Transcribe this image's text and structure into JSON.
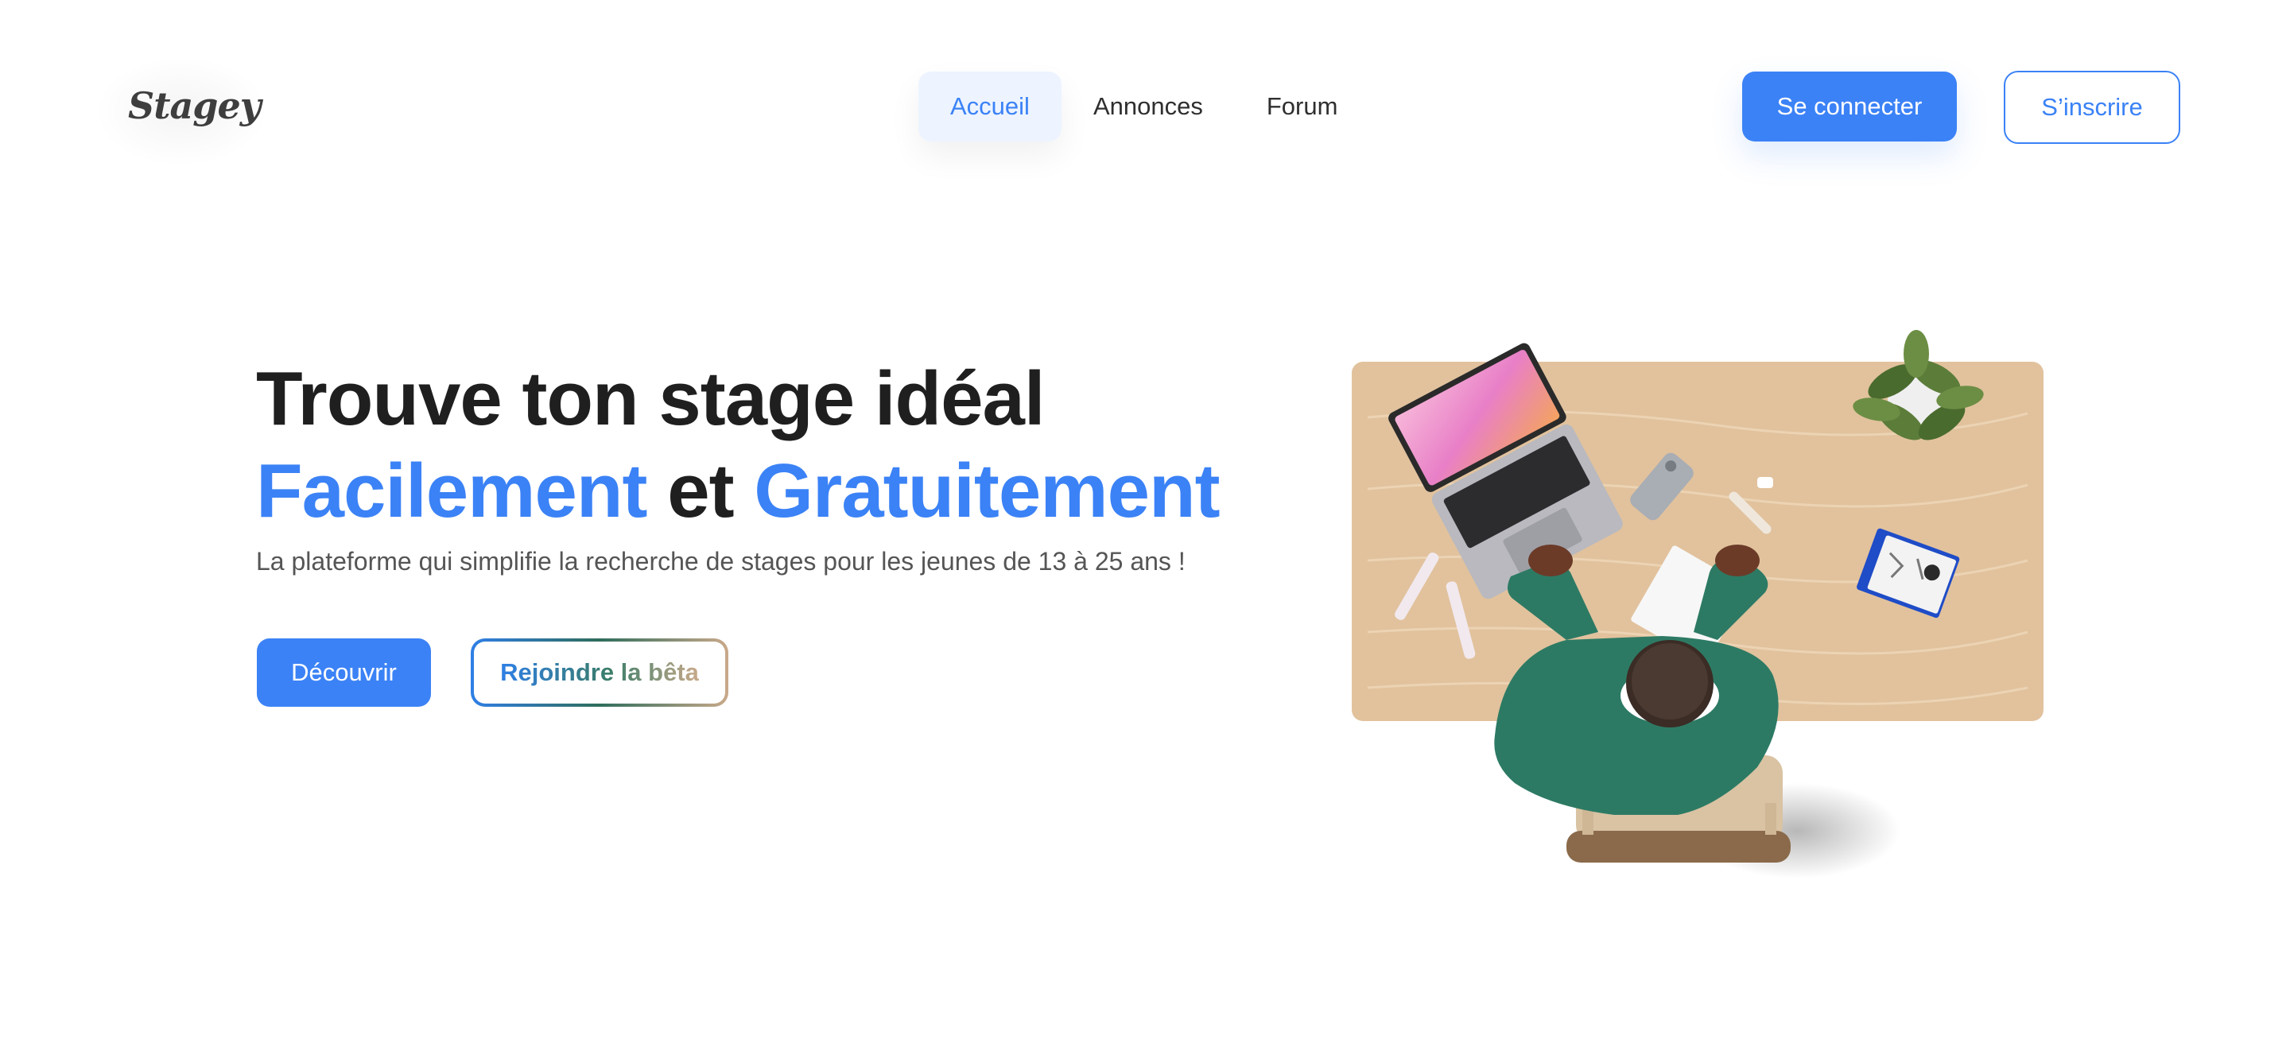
{
  "header": {
    "logo": "Stagey",
    "nav": [
      {
        "label": "Accueil",
        "active": true
      },
      {
        "label": "Annonces",
        "active": false
      },
      {
        "label": "Forum",
        "active": false
      }
    ],
    "login_label": "Se connecter",
    "signup_label": "S’inscrire"
  },
  "hero": {
    "title_line1": "Trouve ton stage idéal",
    "title_word1": "Facilement",
    "title_and": "et",
    "title_word2": "Gratuitement",
    "subtitle": "La plateforme qui simplifie la recherche de stages pour les jeunes de 13 à 25 ans !",
    "discover_label": "Découvrir",
    "beta_label": "Rejoindre la bêta"
  },
  "colors": {
    "accent": "#3b82f6",
    "nav_active_bg": "#edf4ff",
    "desk": "#e1c29d",
    "sweater": "#2d7a64"
  },
  "icons": [
    "laptop-icon",
    "phone-icon",
    "plant-icon",
    "person-icon"
  ]
}
